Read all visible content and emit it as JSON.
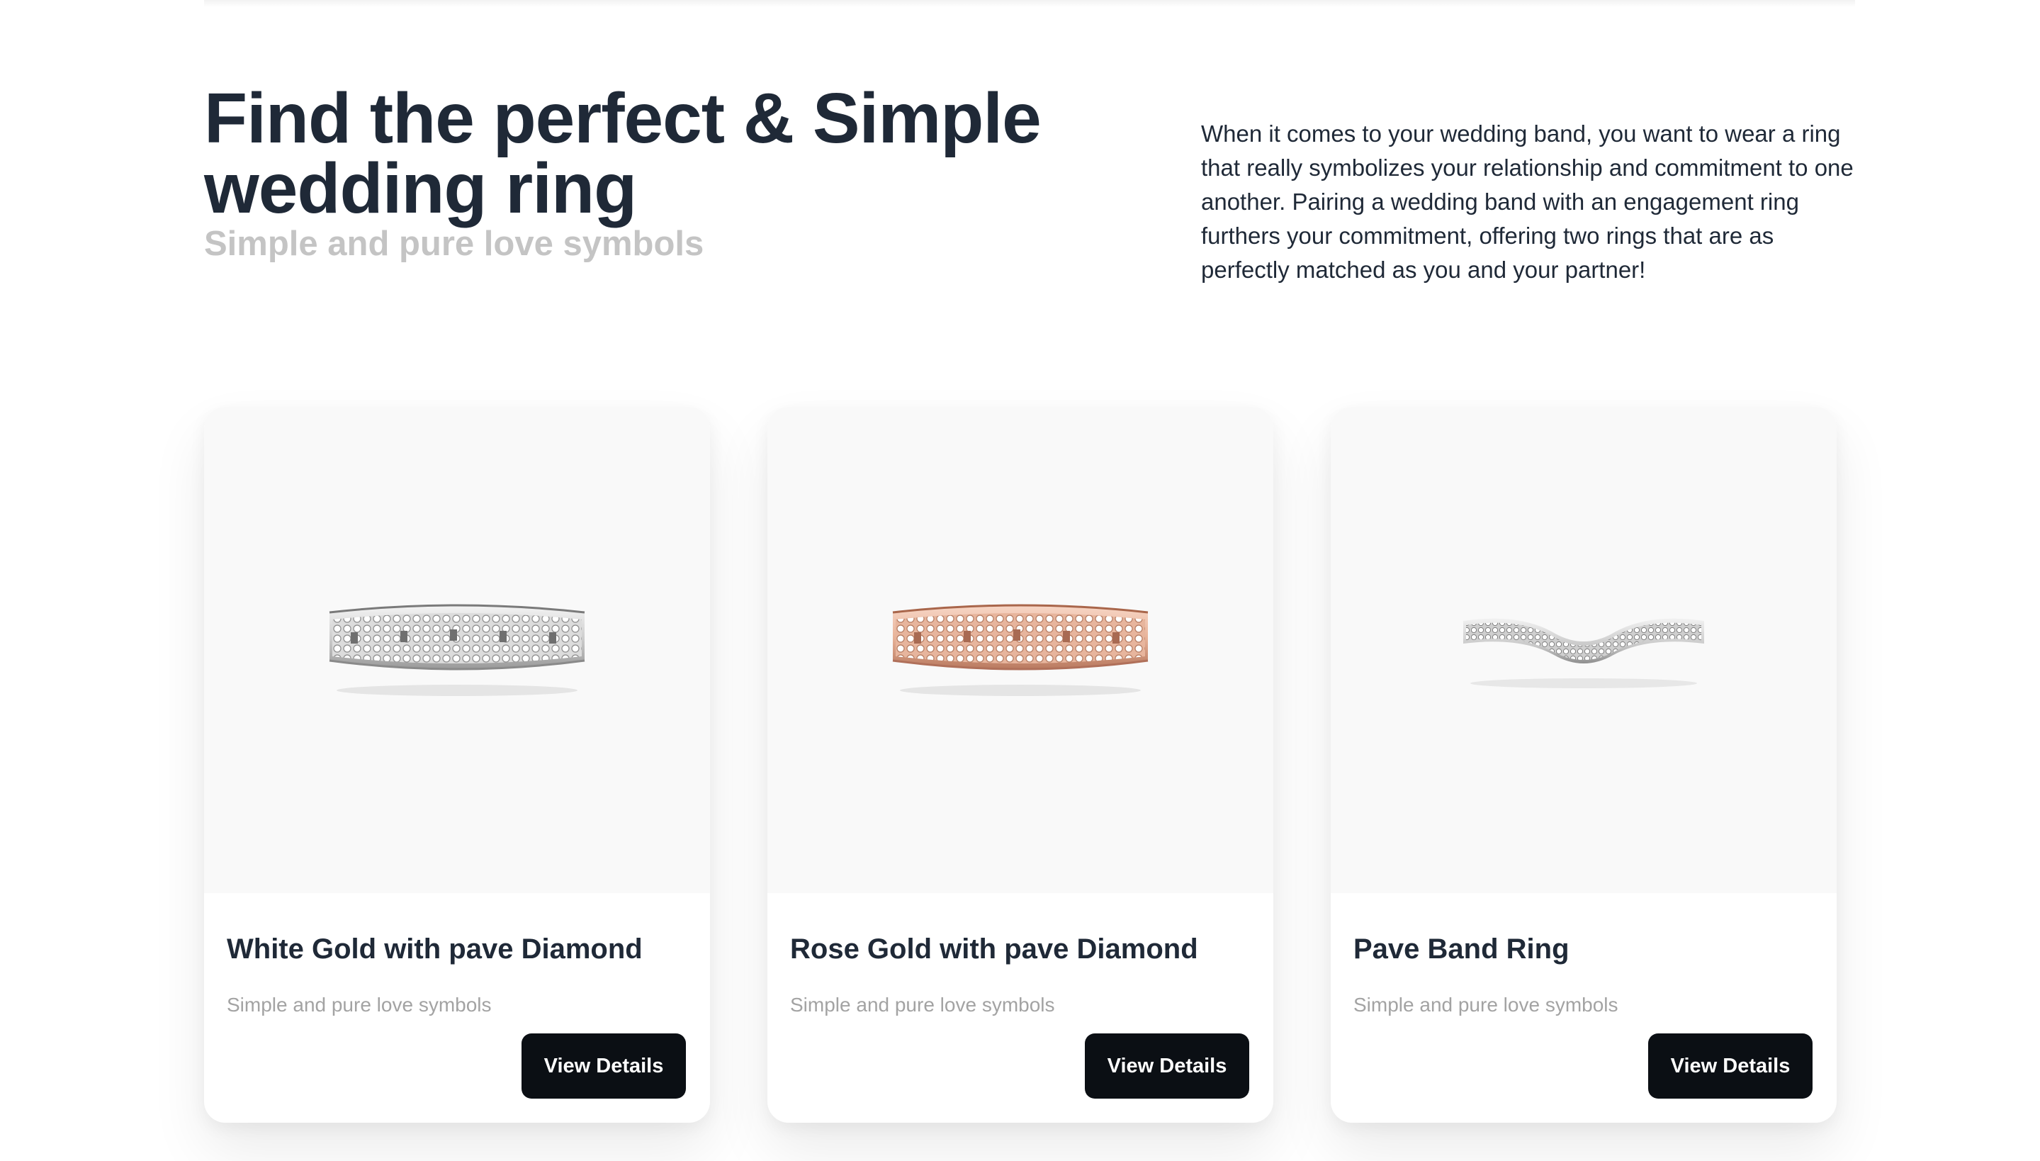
{
  "hero": {
    "title": "Find the perfect & Simple wedding ring",
    "subtitle": "Simple and pure love symbols",
    "description": "When it comes to your wedding band, you want to wear a ring that really symbolizes your relationship and commitment to one another. Pairing a wedding band with an engagement ring furthers your commitment, offering two rings that are as perfectly matched as you and your partner!"
  },
  "products": [
    {
      "title": "White Gold with pave Diamond",
      "subtitle": "Simple and pure love symbols",
      "button": "View Details",
      "image_icon": "white-gold-ring",
      "metal_color": "#d4d4d4"
    },
    {
      "title": "Rose Gold with pave Diamond",
      "subtitle": "Simple and pure love symbols",
      "button": "View Details",
      "image_icon": "rose-gold-ring",
      "metal_color": "#e8b399"
    },
    {
      "title": "Pave Band Ring",
      "subtitle": "Simple and pure love symbols",
      "button": "View Details",
      "image_icon": "curved-pave-ring",
      "metal_color": "#cfcfcf"
    }
  ],
  "colors": {
    "heading": "#1f2937",
    "muted": "#a3a3a3",
    "button_bg": "#0b0f14",
    "card_image_bg": "#f9f9f9"
  }
}
